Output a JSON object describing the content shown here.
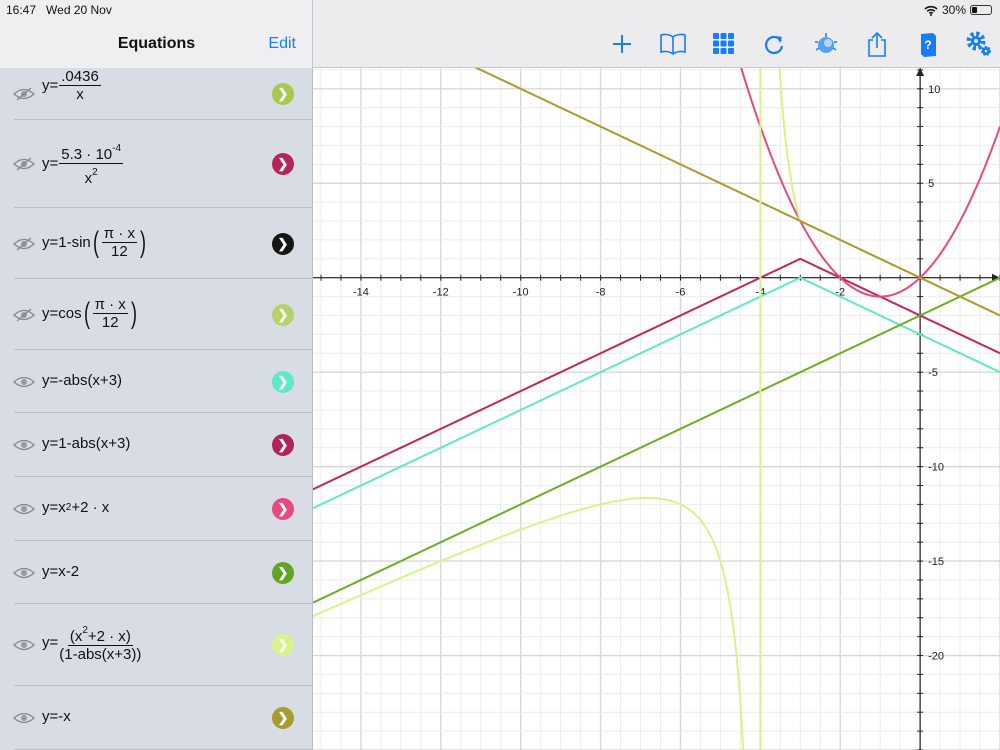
{
  "status": {
    "time": "16:47",
    "date": "Wed 20 Nov",
    "battery": "30%",
    "battery_level": 0.3
  },
  "sidebar": {
    "title": "Equations",
    "edit": "Edit"
  },
  "toolbar": [
    "add",
    "library",
    "keypad",
    "refresh",
    "graph-style",
    "share",
    "help",
    "settings"
  ],
  "equations": [
    {
      "hidden": true,
      "color": "#a9c94c",
      "lhs": "y=",
      "num": ".0436",
      "den": "x"
    },
    {
      "hidden": true,
      "color": "#b6245a",
      "lhs": "y=",
      "num": "5.3 · 10",
      "num_sup": "-4",
      "den": "x",
      "den_sup": "2"
    },
    {
      "hidden": true,
      "color": "#151515",
      "lhs": "y=1-sin",
      "num": "π · x",
      "den": "12"
    },
    {
      "hidden": true,
      "color": "#b4d46a",
      "lhs": "y=cos",
      "num": "π · x",
      "den": "12"
    },
    {
      "hidden": false,
      "color": "#5fe8c9",
      "text": "y=-abs(x+3)"
    },
    {
      "hidden": false,
      "color": "#b0245a",
      "text": "y=1-abs(x+3)"
    },
    {
      "hidden": false,
      "color": "#e9497c",
      "lhs": "y=x",
      "sup": "2",
      "rest": "+2 · x"
    },
    {
      "hidden": false,
      "color": "#5ea523",
      "text": "y=x-2"
    },
    {
      "hidden": false,
      "color": "#d7f38a",
      "lhs": "y=",
      "num_a": "x",
      "num_sup": "2",
      "num_b": "+2 · x",
      "den": "(1-abs(x+3))"
    },
    {
      "hidden": false,
      "color": "#a99b2d",
      "text": "y=-x"
    }
  ],
  "chart_data": {
    "type": "line",
    "xlim": [
      -15.2,
      2.0
    ],
    "ylim": [
      -25,
      11.1
    ],
    "x_ticks": [
      "-14",
      "-12",
      "-10",
      "-8",
      "-6",
      "-4",
      "-2"
    ],
    "x_tick_values": [
      -14,
      -12,
      -10,
      -8,
      -6,
      -4,
      -2
    ],
    "y_ticks": [
      "10",
      "5",
      "-5",
      "-10",
      "-15",
      "-20"
    ],
    "y_tick_values": [
      10,
      5,
      -5,
      -10,
      -15,
      -20
    ],
    "grid": true,
    "series": [
      {
        "name": "y=-abs(x+3)",
        "color": "#5fe8c9"
      },
      {
        "name": "y=1-abs(x+3)",
        "color": "#c4255e"
      },
      {
        "name": "y=x^2+2x",
        "color": "#e9497c"
      },
      {
        "name": "y=x-2",
        "color": "#6aae22"
      },
      {
        "name": "y=(x^2+2x)/(1-abs(x+3))",
        "color": "#d7f38a"
      },
      {
        "name": "y=-x",
        "color": "#a99b2d"
      }
    ]
  }
}
